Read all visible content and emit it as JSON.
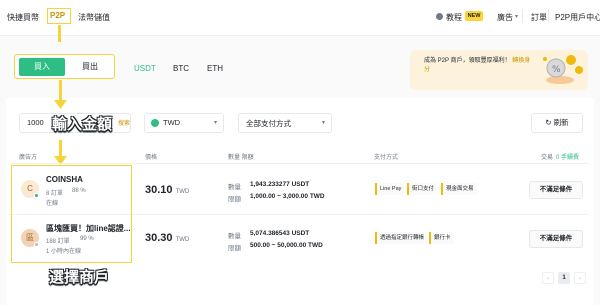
{
  "nav": {
    "items": [
      "快捷買幣",
      "P2P",
      "法幣儲值"
    ],
    "right": {
      "tutorial": "教程",
      "new_badge": "NEW",
      "ads": "廣告",
      "orders": "訂單",
      "user_center": "P2P用戶中心"
    }
  },
  "trade": {
    "buy_label": "買入",
    "sell_label": "買出",
    "coins": [
      "USDT",
      "BTC",
      "ETH"
    ],
    "active_coin": "USDT"
  },
  "promo": {
    "text": "成為 P2P 商戶，領取豐厚福利！",
    "link": "轉換身分"
  },
  "filters": {
    "amount_value": "1000",
    "amount_suffix": "搜索",
    "currency": "TWD",
    "payment": "全部支付方式",
    "refresh_label": "刷新"
  },
  "table": {
    "headers": {
      "advertiser": "廣告方",
      "price": "價格",
      "limit": "數量 限額",
      "payment": "支付方式",
      "trade": "交易",
      "fee": "0 手續費"
    },
    "rows": [
      {
        "avatar": "C",
        "name": "COINSHA",
        "orders": "8 訂單",
        "rate": "88 %",
        "status": "在線",
        "price": "30.10",
        "unit": "TWD",
        "qty_label": "數量",
        "qty": "1,943.233277 USDT",
        "limit_label": "限額",
        "limit": "1,000.00 ~ 3,000.00 TWD",
        "payments": [
          "Line Pay",
          "街口支付",
          "現金面交易"
        ],
        "action": "不滿足條件"
      },
      {
        "avatar": "區",
        "name": "區塊匯買！加line認證...",
        "orders": "188 訂單",
        "rate": "99 %",
        "status": "1 小時內在線",
        "price": "30.30",
        "unit": "TWD",
        "qty_label": "數量",
        "qty": "5,074.386543 USDT",
        "limit_label": "限額",
        "limit": "500.00 ~ 50,000.00 TWD",
        "payments": [
          "透過指定銀行轉帳",
          "銀行卡"
        ],
        "action": "不滿足條件"
      }
    ]
  },
  "pagination": {
    "current": "1"
  },
  "annotations": {
    "amount": "輸入金額",
    "merchant": "選擇商戶"
  },
  "colors": {
    "green": "#2ebd85",
    "highlight": "#f5d43b",
    "gold": "#c99400"
  },
  "icons": [
    "coin-circle-icon",
    "refresh-icon",
    "chevron-down-icon",
    "tutorial-icon",
    "gift-icon",
    "taiwan-flag-icon"
  ]
}
